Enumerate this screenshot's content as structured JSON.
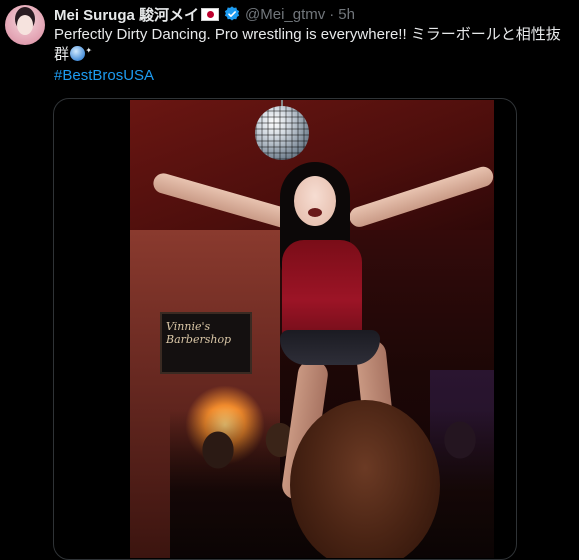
{
  "tweet": {
    "author": {
      "display_name": "Mei Suruga 駿河メイ",
      "handle": "@Mei_gtmv",
      "separator": "·",
      "time": "5h",
      "verified_color": "#1d9bf0",
      "flag_icon": "japan-flag-icon"
    },
    "text_line1": "Perfectly Dirty Dancing. Pro wrestling is everywhere!! ミラーボールと相性抜",
    "text_line2": "群",
    "emoji_icon": "mirror-ball-icon",
    "hashtag": "#BestBrosUSA",
    "hashtag_color": "#1d9bf0"
  },
  "media": {
    "type": "video",
    "sign_text_line1": "Vinnie's",
    "sign_text_line2": "Barbershop"
  }
}
